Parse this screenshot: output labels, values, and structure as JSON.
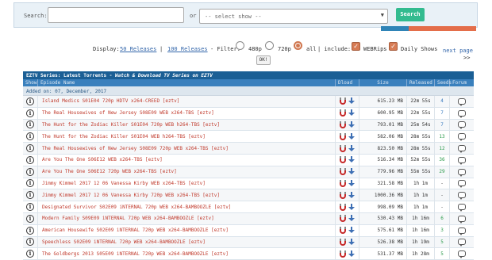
{
  "search": {
    "label": "Search:",
    "or_label": "or",
    "select_value": "-- select show --",
    "button_label": "Search"
  },
  "filter": {
    "display_label": "Display:",
    "opt_50": "50 Releases",
    "separator": "|",
    "opt_100": "100 Releases",
    "filter_label": "- Filter:",
    "res_480": "480p",
    "res_720": "720p",
    "res_all": "all",
    "include_label": "| include:",
    "webrips": "WEBRips",
    "daily": "Daily Shows",
    "next_page": "next page",
    "next_arrows": ">>",
    "ok": "OK!",
    "selected_resolution": "all"
  },
  "table": {
    "title": "EZTV Series: Latest Torrents - ",
    "title_italic": "Watch & Download TV Series on EZTV",
    "headers": {
      "show": "Show",
      "name": "Episode Name",
      "dload": "Dload",
      "size": "Size",
      "released": "Released",
      "seeds": "Seeds",
      "forum": "Forum"
    },
    "added_on": "Added on: 07, December, 2017",
    "rows": [
      {
        "name": "Island Medics S01E04 720p HDTV x264-CREED [eztv]",
        "size": "615.23 MB",
        "released": "22m 55s",
        "seeds": "4",
        "seed_color": "blue"
      },
      {
        "name": "The Real Housewives of New Jersey S08E09 WEB x264-TBS [eztv]",
        "size": "600.95 MB",
        "released": "22m 55s",
        "seeds": "7",
        "seed_color": "blue"
      },
      {
        "name": "The Hunt for the Zodiac Killer S01E04 720p WEB h264-TBS [eztv]",
        "size": "793.01 MB",
        "released": "25m 54s",
        "seeds": "7",
        "seed_color": "blue"
      },
      {
        "name": "The Hunt for the Zodiac Killer S01E04 WEB h264-TBS [eztv]",
        "size": "582.06 MB",
        "released": "28m 55s",
        "seeds": "13",
        "seed_color": "green"
      },
      {
        "name": "The Real Housewives of New Jersey S08E09 720p WEB x264-TBS [eztv]",
        "size": "823.50 MB",
        "released": "28m 55s",
        "seeds": "12",
        "seed_color": "green"
      },
      {
        "name": "Are You The One S06E12 WEB x264-TBS [eztv]",
        "size": "516.34 MB",
        "released": "52m 55s",
        "seeds": "36",
        "seed_color": "green"
      },
      {
        "name": "Are You The One S06E12 720p WEB x264-TBS [eztv]",
        "size": "779.96 MB",
        "released": "55m 55s",
        "seeds": "29",
        "seed_color": "green"
      },
      {
        "name": "Jimmy Kimmel 2017 12 06 Vanessa Kirby WEB x264-TBS [eztv]",
        "size": "321.58 MB",
        "released": "1h 1m",
        "seeds": "-",
        "seed_color": "dash"
      },
      {
        "name": "Jimmy Kimmel 2017 12 06 Vanessa Kirby 720p WEB x264-TBS [eztv]",
        "size": "1000.36 MB",
        "released": "1h 1m",
        "seeds": "-",
        "seed_color": "dash"
      },
      {
        "name": "Designated Survivor S02E09 iNTERNAL 720p WEB x264-BAMBOOZLE [eztv]",
        "size": "998.09 MB",
        "released": "1h 1m",
        "seeds": "-",
        "seed_color": "dash"
      },
      {
        "name": "Modern Family S09E09 iNTERNAL 720p WEB x264-BAMBOOZLE [eztv]",
        "size": "530.43 MB",
        "released": "1h 16m",
        "seeds": "6",
        "seed_color": "green"
      },
      {
        "name": "American Housewife S02E09 iNTERNAL 720p WEB x264-BAMBOOZLE [eztv]",
        "size": "575.61 MB",
        "released": "1h 16m",
        "seeds": "3",
        "seed_color": "green"
      },
      {
        "name": "Speechless S02E09 iNTERNAL 720p WEB x264-BAMBOOZLE [eztv]",
        "size": "526.38 MB",
        "released": "1h 19m",
        "seeds": "5",
        "seed_color": "green"
      },
      {
        "name": "The Goldbergs 2013 S05E09 iNTERNAL 720p WEB x264-BAMBOOZLE [eztv]",
        "size": "531.37 MB",
        "released": "1h 28m",
        "seeds": "5",
        "seed_color": "green"
      }
    ]
  }
}
